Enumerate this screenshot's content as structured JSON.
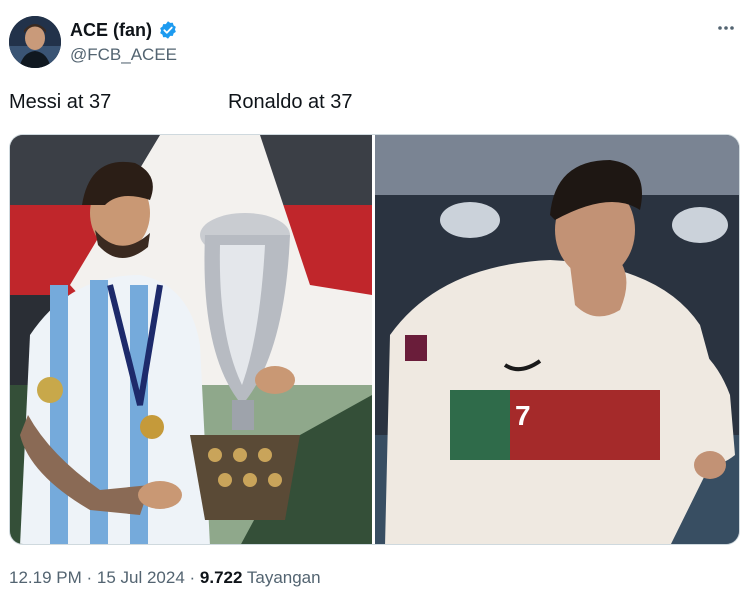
{
  "author": {
    "display_name": "ACE (fan)",
    "handle": "@FCB_ACEE",
    "verified": true,
    "avatar_icon": "profile-photo-icon"
  },
  "tweet": {
    "text": "Messi at 37                     Ronaldo at 37"
  },
  "media": {
    "left_image": "player-lifting-trophy-photo",
    "right_image": "player-covering-face-photo",
    "jersey_number": "7"
  },
  "meta": {
    "time": "12.19 PM",
    "separator": " · ",
    "date": "15 Jul 2024",
    "views_count": "9.722",
    "views_label": "Tayangan"
  },
  "colors": {
    "verified": "#1d9bf0",
    "secondary_text": "#536471",
    "primary_text": "#0f1419"
  }
}
